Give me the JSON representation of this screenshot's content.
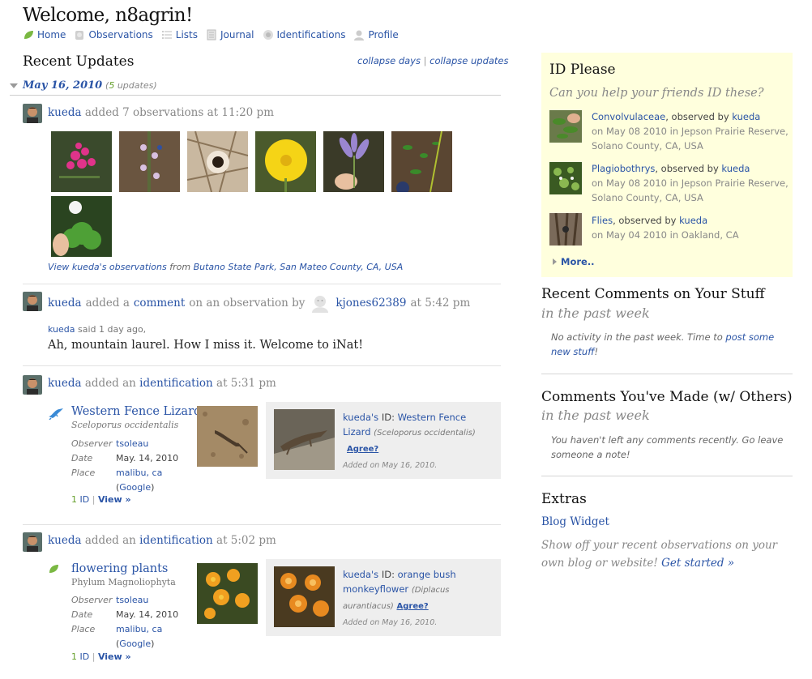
{
  "header": {
    "welcome": "Welcome, n8agrin!",
    "nav": [
      "Home",
      "Observations",
      "Lists",
      "Journal",
      "Identifications",
      "Profile"
    ]
  },
  "recent_updates": {
    "title": "Recent Updates",
    "collapse_days": "collapse days",
    "collapse_separator": "|",
    "collapse_updates": "collapse updates",
    "day": {
      "date": "May 16, 2010",
      "count_open": "(",
      "count": "5",
      "count_close": " updates)"
    }
  },
  "update1": {
    "user": "kueda",
    "text": "added 7 observations at 11:20 pm",
    "view_link": "View kueda's observations",
    "from_text": "from",
    "place_link": "Butano State Park, San Mateo County, CA, USA"
  },
  "update2": {
    "user": "kueda",
    "text_a": "added a",
    "comment_link": "comment",
    "text_b": "on an observation by",
    "other_user": "kjones62389",
    "time": "at 5:42 pm",
    "said_user": "kueda",
    "said_text": "said 1 day ago,",
    "comment": "Ah, mountain laurel. How I miss it. Welcome to iNat!"
  },
  "update3": {
    "user": "kueda",
    "text_a": "added an",
    "ident_link": "identification",
    "time": "at 5:31 pm",
    "taxon": "Western Fence Lizard",
    "sci": "Sceloporus occidentalis",
    "observer_label": "Observer",
    "observer": "tsoleau",
    "date_label": "Date",
    "date": "May. 14, 2010",
    "place_label": "Place",
    "place": "malibu, ca",
    "google": "Google",
    "ids_count": "1",
    "ids_label": "ID",
    "view": "View »",
    "id_user": "kueda's",
    "id_label": "ID:",
    "id_taxon_a": "Western Fence",
    "id_taxon_b": "Lizard",
    "id_sci": "(Sceloporus occidentalis)",
    "agree": "Agree?",
    "added": "Added on May 16, 2010."
  },
  "update4": {
    "user": "kueda",
    "text_a": "added an",
    "ident_link": "identification",
    "time": "at 5:02 pm",
    "taxon": "flowering plants",
    "sci": "Phylum Magnoliophyta",
    "observer_label": "Observer",
    "observer": "tsoleau",
    "date_label": "Date",
    "date": "May. 14, 2010",
    "place_label": "Place",
    "place": "malibu, ca",
    "google": "Google",
    "ids_count": "1",
    "ids_label": "ID",
    "view": "View »",
    "id_user": "kueda's",
    "id_label": "ID:",
    "id_taxon_a": "orange bush",
    "id_taxon_b": "monkeyflower",
    "id_sci_a": "(Diplacus",
    "id_sci_b": "aurantiacus)",
    "agree": "Agree?",
    "added": "Added on May 16, 2010."
  },
  "id_please": {
    "title": "ID Please",
    "subtitle": "Can you help your friends ID these?",
    "items": [
      {
        "taxon": "Convolvulaceae",
        "observed_by": ", observed by",
        "user": "kueda",
        "line2": "on May 08 2010 in Jepson Prairie Reserve,",
        "line3": "Solano County, CA, USA"
      },
      {
        "taxon": "Plagiobothrys",
        "observed_by": ", observed by",
        "user": "kueda",
        "line2": "on May 08 2010 in Jepson Prairie Reserve,",
        "line3": "Solano County, CA, USA"
      },
      {
        "taxon": "Flies",
        "observed_by": ", observed by",
        "user": "kueda",
        "line2": "on May 04 2010 in Oakland, CA",
        "line3": ""
      }
    ],
    "more": "More.."
  },
  "recent_comments": {
    "title": "Recent Comments on Your Stuff",
    "subtitle": "in the past week",
    "note": "No activity in the past week. Time to",
    "link_a": "post some",
    "link_b": "new stuff",
    "end": "!"
  },
  "comments_made": {
    "title": "Comments You've Made (w/ Others)",
    "subtitle": "in the past week",
    "note_a": "You haven't left any comments recently. Go leave",
    "note_b": "someone a note!"
  },
  "extras": {
    "title": "Extras",
    "widget": "Blog Widget",
    "desc_a": "Show off your recent observations on your",
    "desc_b": "own blog or website!",
    "get_started": "Get started »"
  },
  "colors": {
    "link": "#2a54a6",
    "id_please_bg": "#ffffdd",
    "id_box_bg": "#eeeeee",
    "count_green": "#66a02c"
  }
}
